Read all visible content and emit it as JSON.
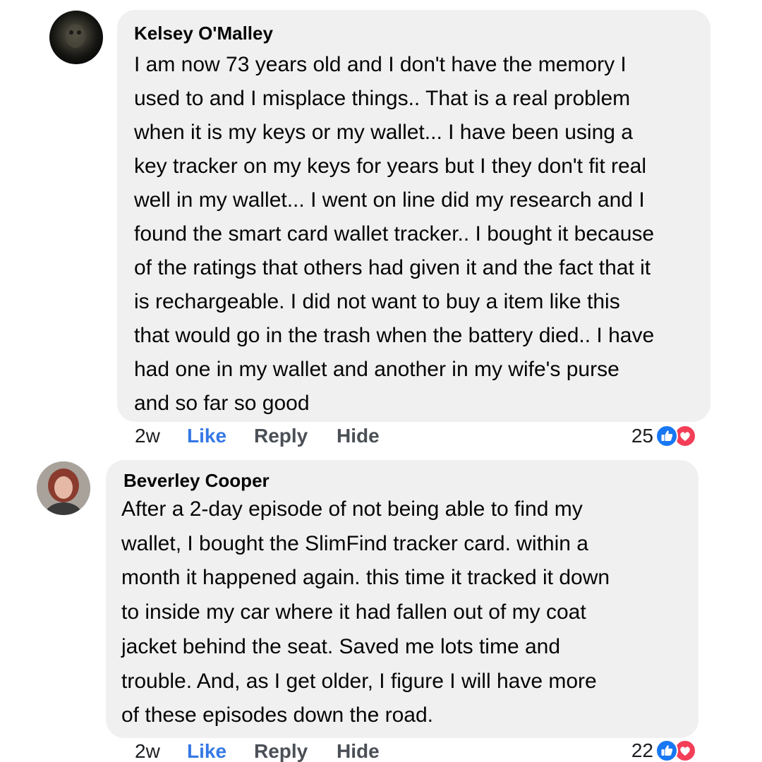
{
  "comments": [
    {
      "author": "Kelsey O'Malley",
      "lines": [
        "I am now 73 years old and I don't have the memory I",
        "used to and I misplace things.. That is a real problem",
        "when it is my keys or my wallet... I have been using a",
        "key tracker on my keys for years but I they don't fit real",
        "well in my wallet... I went on line did my research and I",
        "found the smart card wallet tracker.. I bought it because",
        "of the ratings that others had given it and the fact that it",
        "is rechargeable. I did not want to buy a item like this",
        "that would go in the trash when the battery died.. I have",
        "had one in my wallet and another in my wife's purse",
        "and so far so good"
      ],
      "time": "2w",
      "like_label": "Like",
      "reply_label": "Reply",
      "hide_label": "Hide",
      "reaction_count": "25",
      "reaction_icons": [
        "like-icon",
        "love-icon"
      ]
    },
    {
      "author": "Beverley Cooper",
      "lines": [
        "After a 2-day episode of not being able to find my",
        "wallet, I bought the SlimFind tracker card. within a",
        "month it happened again. this time it tracked it down",
        "to inside my car where it had fallen out of my coat",
        "jacket behind the seat. Saved me lots time and",
        "trouble. And, as I get older, I figure I will have more",
        "of these episodes down the road."
      ],
      "time": "2w",
      "like_label": "Like",
      "reply_label": "Reply",
      "hide_label": "Hide",
      "reaction_count": "22",
      "reaction_icons": [
        "like-icon",
        "love-icon"
      ]
    }
  ],
  "colors": {
    "bubble_bg": "#f0f0f0",
    "like_blue": "#3578e5",
    "love_red": "#f33e58",
    "action_gray": "#4b4f56"
  }
}
